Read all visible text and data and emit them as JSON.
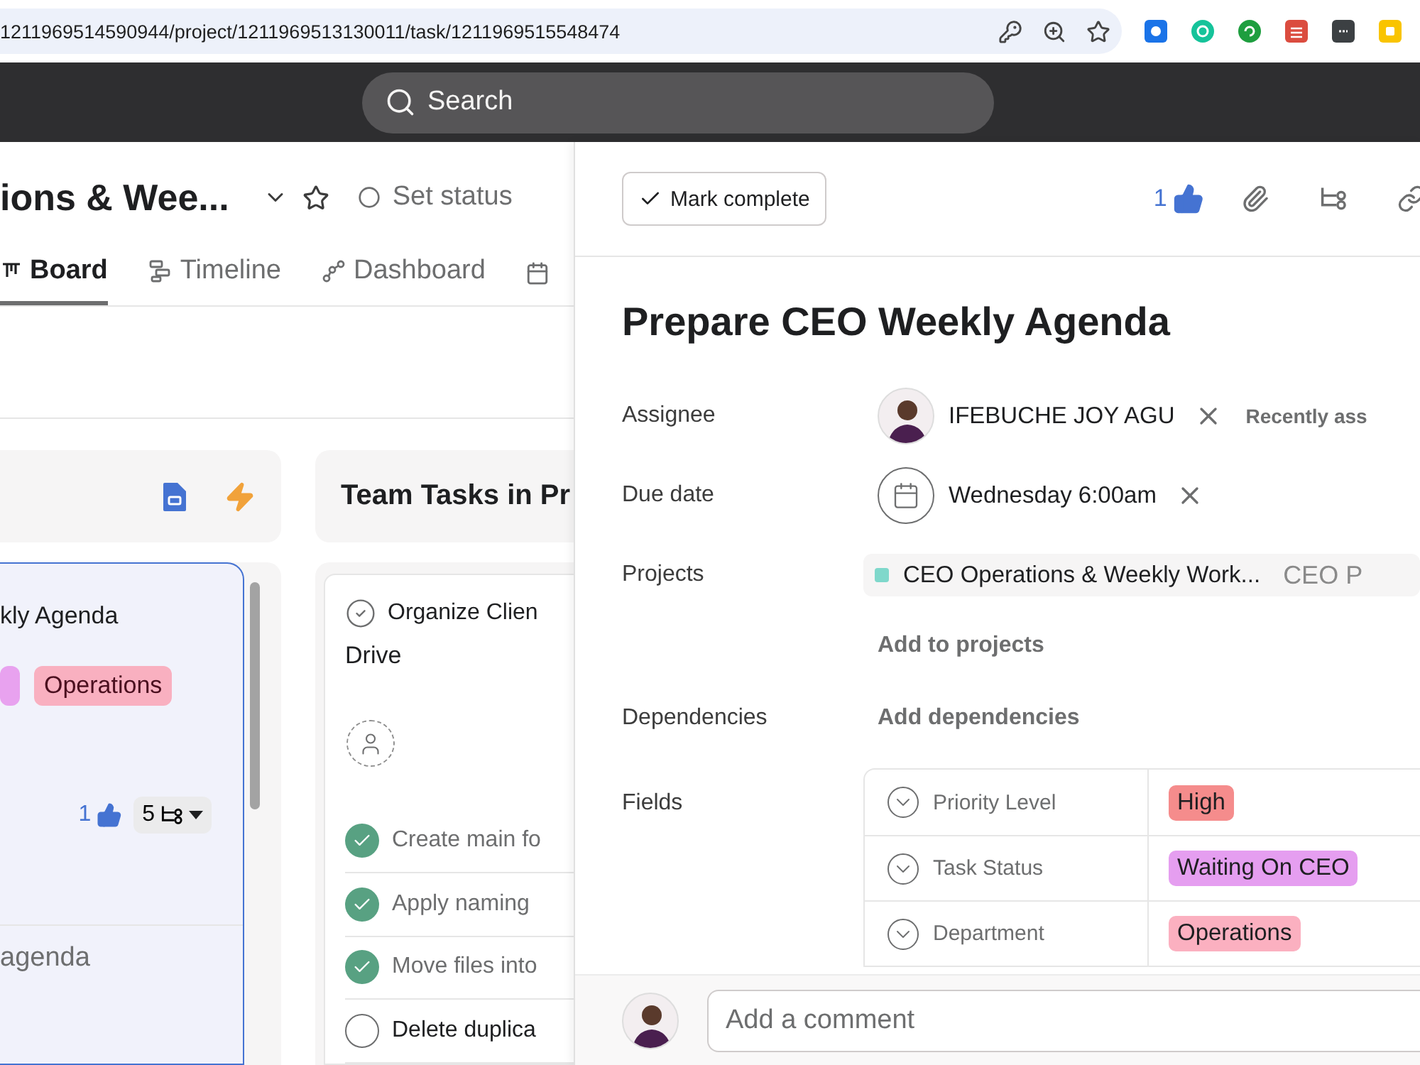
{
  "browser": {
    "url": "1211969514590944/project/1211969513130011/task/1211969515548474"
  },
  "search": {
    "placeholder": "Search"
  },
  "project": {
    "title": "ions & Wee...",
    "status": "Set status",
    "tabs": [
      {
        "label": "Board",
        "selected": true
      },
      {
        "label": "Timeline",
        "selected": false
      },
      {
        "label": "Dashboard",
        "selected": false
      }
    ]
  },
  "board": {
    "columns": [
      {
        "cards": [
          {
            "title": "kly Agenda",
            "selected": true,
            "tags": [
              {
                "color": "#e8a2ef"
              },
              {
                "label": "Operations",
                "color": "#f9b0c0"
              }
            ],
            "likes": "1",
            "subtask_count": "5",
            "subtasks": [
              "agenda"
            ]
          }
        ]
      },
      {
        "title": "Team Tasks in Pr",
        "cards": [
          {
            "title_lines": [
              "Organize Clien",
              "Drive"
            ],
            "selected": false,
            "subtasks": [
              {
                "title": "Create main fo",
                "completed": true
              },
              {
                "title": "Apply naming",
                "completed": true
              },
              {
                "title": "Move files into",
                "completed": true
              },
              {
                "title": "Delete duplica",
                "completed": false
              }
            ]
          }
        ]
      }
    ]
  },
  "task": {
    "mark_complete": "Mark complete",
    "likes": "1",
    "title": "Prepare CEO Weekly Agenda",
    "assignee": {
      "label": "Assignee",
      "name": "IFEBUCHE JOY AGU",
      "hint": "Recently ass"
    },
    "due_date": {
      "label": "Due date",
      "value": "Wednesday 6:00am"
    },
    "projects": {
      "label": "Projects",
      "items": [
        {
          "name": "CEO Operations & Weekly Work...",
          "section": "CEO P",
          "color": "#7fd8cb"
        }
      ],
      "add": "Add to projects"
    },
    "dependencies": {
      "label": "Dependencies",
      "add": "Add dependencies"
    },
    "fields": {
      "label": "Fields",
      "rows": [
        {
          "name": "Priority Level",
          "value": "High",
          "color": "#f58c8c"
        },
        {
          "name": "Task Status",
          "value": "Waiting On CEO",
          "color": "#e59ef0"
        },
        {
          "name": "Department",
          "value": "Operations",
          "color": "#fbb0c0"
        }
      ]
    },
    "comment": {
      "placeholder": "Add a comment"
    }
  }
}
